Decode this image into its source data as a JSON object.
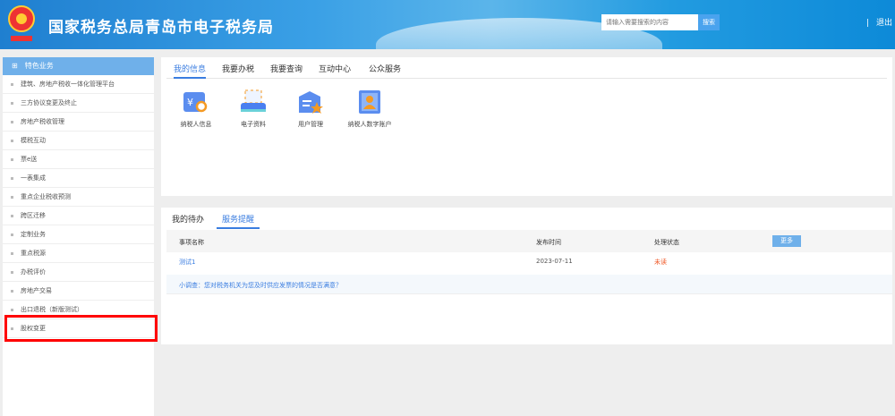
{
  "header": {
    "title": "国家税务总局青岛市电子税务局",
    "search_placeholder": "请输入需要搜索的内容",
    "search_label": "搜索",
    "separator": "|",
    "logout_label": "退出"
  },
  "sidebar": {
    "title": "特色业务",
    "items": [
      "建筑、房地产税收一体化管理平台",
      "三方协议变更及终止",
      "房地产税收管理",
      "模税互动",
      "票e送",
      "一表集成",
      "重点企业税收预测",
      "跨区迁移",
      "定制业务",
      "重点税源",
      "办税评价",
      "房地产交易",
      "出口退税（新版测试）",
      "股权变更"
    ],
    "highlighted": "股权变更"
  },
  "main": {
    "tabs": [
      "我的信息",
      "我要办税",
      "我要查询",
      "互动中心",
      "公众服务"
    ],
    "active_tab": "我的信息",
    "icons": [
      {
        "label": "纳税人信息",
        "icon": "taxpayer-info-icon"
      },
      {
        "label": "电子资料",
        "icon": "e-documents-icon"
      },
      {
        "label": "用户管理",
        "icon": "user-management-icon"
      },
      {
        "label": "纳税人数字账户",
        "icon": "digital-account-icon"
      }
    ]
  },
  "notices": {
    "tabs": [
      "我的待办",
      "服务提醒"
    ],
    "active_tab": "服务提醒",
    "columns": [
      "事项名称",
      "发布时间",
      "处理状态"
    ],
    "more_label": "更多",
    "rows": [
      {
        "name": "测试1",
        "date": "2023-07-11",
        "status": "未读"
      }
    ],
    "survey": "小调查：您对税务机关为您及时供应发票的情况是否满意？"
  },
  "colors": {
    "accent": "#3a7de0",
    "sidebar_head": "#6fb0ea",
    "unread": "#f05a28",
    "highlight": "#ff0000"
  }
}
